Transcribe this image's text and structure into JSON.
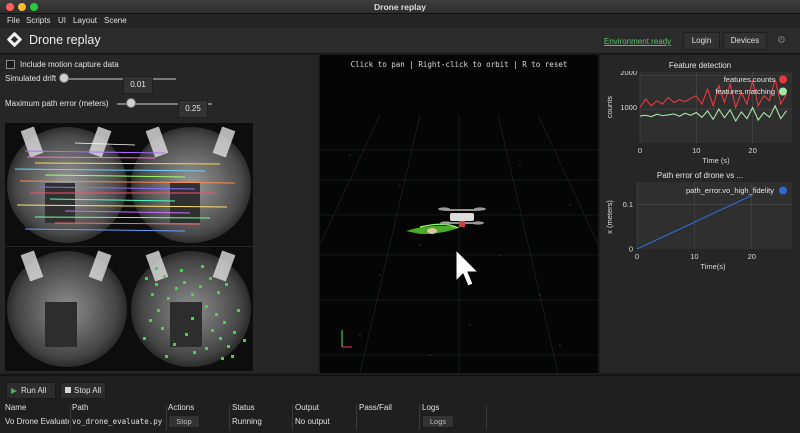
{
  "window": {
    "title": "Drone replay"
  },
  "menu": {
    "items": [
      "File",
      "Scripts",
      "UI",
      "Layout",
      "Scene"
    ]
  },
  "header": {
    "title": "Drone replay",
    "environment_status": "Environment ready",
    "login_label": "Login",
    "devices_label": "Devices",
    "status_color": "#55c468"
  },
  "controls": {
    "motion_capture_label": "Include motion capture data",
    "motion_capture_checked": false,
    "drift_label": "Simulated drift",
    "drift_value": "0.01",
    "path_error_label": "Maximum path error (meters)",
    "path_error_value": "0.25"
  },
  "viewport": {
    "hint": "Click to pan | Right-click to orbit | R to reset"
  },
  "plots": {
    "feature_detection": {
      "title": "Feature detection",
      "ylabel": "counts",
      "xlabel": "Time (s)",
      "yticks": [
        "2000",
        "1000"
      ],
      "xticks": [
        "0",
        "10",
        "20"
      ],
      "legend": [
        "features.counts",
        "features.matching"
      ],
      "colors": [
        "#e8383d",
        "#a6e6a6"
      ]
    },
    "path_error": {
      "title": "Path error of drone vs ...",
      "ylabel": "x (meters)",
      "xlabel": "Time(s)",
      "yticks": [
        "0.1",
        "0"
      ],
      "xticks": [
        "0",
        "10",
        "20"
      ],
      "legend": [
        "path_error.vo_high_fidelity"
      ],
      "color": "#2f6ad0"
    }
  },
  "chart_data": [
    {
      "type": "line",
      "title": "Feature detection",
      "xlabel": "Time (s)",
      "ylabel": "counts",
      "xlim": [
        0,
        27
      ],
      "ylim": [
        0,
        2100
      ],
      "series": [
        {
          "name": "features.counts",
          "x": [
            0,
            1,
            2,
            3,
            4,
            5,
            6,
            7,
            8,
            9,
            10,
            11,
            12,
            13,
            14,
            15,
            16,
            17,
            18,
            19,
            20,
            21,
            22,
            23,
            24,
            25,
            26
          ],
          "values": [
            1050,
            1300,
            1100,
            1250,
            1150,
            1350,
            1200,
            1280,
            1220,
            1320,
            1400,
            1150,
            1600,
            1100,
            1700,
            1200,
            1750,
            1050,
            1500,
            1150,
            1850,
            1100,
            1400,
            1250,
            1900,
            1150,
            1450
          ]
        },
        {
          "name": "features.matching",
          "x": [
            0,
            1,
            2,
            3,
            4,
            5,
            6,
            7,
            8,
            9,
            10,
            11,
            12,
            13,
            14,
            15,
            16,
            17,
            18,
            19,
            20,
            21,
            22,
            23,
            24,
            25,
            26
          ],
          "values": [
            800,
            820,
            780,
            850,
            810,
            830,
            860,
            790,
            880,
            820,
            900,
            760,
            950,
            700,
            1000,
            750,
            980,
            650,
            920,
            720,
            1050,
            680,
            900,
            760,
            1100,
            720,
            950
          ]
        }
      ]
    },
    {
      "type": "line",
      "title": "Path error of drone vs ...",
      "xlabel": "Time(s)",
      "ylabel": "x (meters)",
      "xlim": [
        0,
        27
      ],
      "ylim": [
        0,
        0.15
      ],
      "series": [
        {
          "name": "path_error.vo_high_fidelity",
          "x": [
            0,
            1,
            2,
            3,
            4,
            5,
            6,
            7,
            8,
            9,
            10,
            11,
            12,
            13,
            14,
            15,
            16,
            17,
            18,
            19,
            20
          ],
          "values": [
            0,
            0.006,
            0.012,
            0.018,
            0.024,
            0.03,
            0.036,
            0.042,
            0.048,
            0.054,
            0.06,
            0.066,
            0.072,
            0.078,
            0.084,
            0.09,
            0.096,
            0.102,
            0.108,
            0.114,
            0.12
          ]
        }
      ]
    }
  ],
  "tasks": {
    "run_all_label": "Run All",
    "stop_all_label": "Stop All",
    "columns": [
      "Name",
      "Path",
      "Actions",
      "Status",
      "Output",
      "Pass/Fail",
      "Logs"
    ],
    "rows": [
      {
        "name": "Vo Drone Evaluate",
        "path": "vo_drone_evaluate.py",
        "action": "Stop",
        "status": "Running",
        "output": "No output",
        "pass_fail": "",
        "logs": "Logs"
      }
    ]
  }
}
